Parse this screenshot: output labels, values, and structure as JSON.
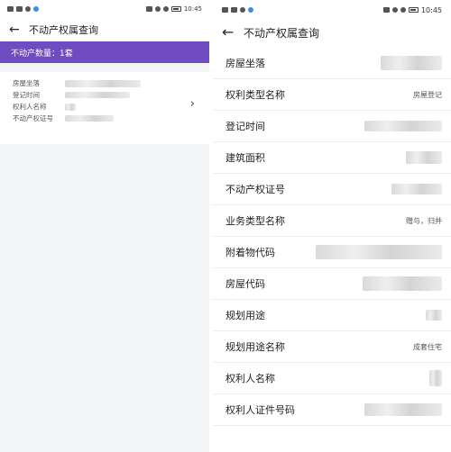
{
  "left_screen": {
    "status_time": "10:45",
    "title": "不动产权属查询",
    "count_text": "不动产数量：1套",
    "card_fields": [
      {
        "label": "房屋坐落"
      },
      {
        "label": "登记时间"
      },
      {
        "label": "权利人名称"
      },
      {
        "label": "不动产权证号"
      }
    ]
  },
  "right_screen": {
    "status_time": "10:45",
    "title": "不动产权属查询",
    "rows": [
      {
        "label": "房屋坐落",
        "value": ""
      },
      {
        "label": "权利类型名称",
        "value": "房屋登记"
      },
      {
        "label": "登记时间",
        "value": ""
      },
      {
        "label": "建筑面积",
        "value": ""
      },
      {
        "label": "不动产权证号",
        "value": ""
      },
      {
        "label": "业务类型名称",
        "value": "赠与，归并"
      },
      {
        "label": "附着物代码",
        "value": ""
      },
      {
        "label": "房屋代码",
        "value": ""
      },
      {
        "label": "规划用途",
        "value": ""
      },
      {
        "label": "规划用途名称",
        "value": "成套住宅"
      },
      {
        "label": "权利人名称",
        "value": ""
      },
      {
        "label": "权利人证件号码",
        "value": ""
      }
    ]
  }
}
